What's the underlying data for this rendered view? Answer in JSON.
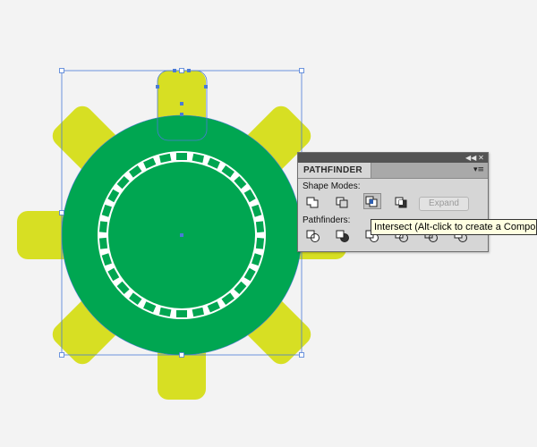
{
  "colors": {
    "background": "#f3f3f3",
    "ring_green": "#00a651",
    "tab_yellow": "#d7df23",
    "white_band": "#ffffff",
    "selection_blue": "#4a7bd6"
  },
  "canvas": {
    "notch_count": 30,
    "tab_count": 8
  },
  "pathfinder": {
    "tab_label": "PATHFINDER",
    "titlebar_collapse_icon": "double-chevron-left-icon",
    "titlebar_close_icon": "close-icon",
    "menu_icon": "panel-menu-icon",
    "shape_modes_label": "Shape Modes:",
    "pathfinders_label": "Pathfinders:",
    "expand_label": "Expand",
    "shape_mode_buttons": [
      {
        "name": "unite",
        "icon": "unite-icon"
      },
      {
        "name": "minus-front",
        "icon": "minus-front-icon"
      },
      {
        "name": "intersect",
        "icon": "intersect-icon",
        "state": "hover"
      },
      {
        "name": "exclude",
        "icon": "exclude-icon"
      }
    ],
    "pathfinder_buttons": [
      {
        "name": "divide",
        "icon": "divide-icon"
      },
      {
        "name": "trim",
        "icon": "trim-icon"
      },
      {
        "name": "merge",
        "icon": "merge-icon"
      },
      {
        "name": "crop",
        "icon": "crop-icon"
      },
      {
        "name": "outline",
        "icon": "outline-icon"
      },
      {
        "name": "minus-back",
        "icon": "minus-back-icon"
      }
    ]
  },
  "tooltip": {
    "text": "Intersect (Alt-click to create a Compou"
  }
}
